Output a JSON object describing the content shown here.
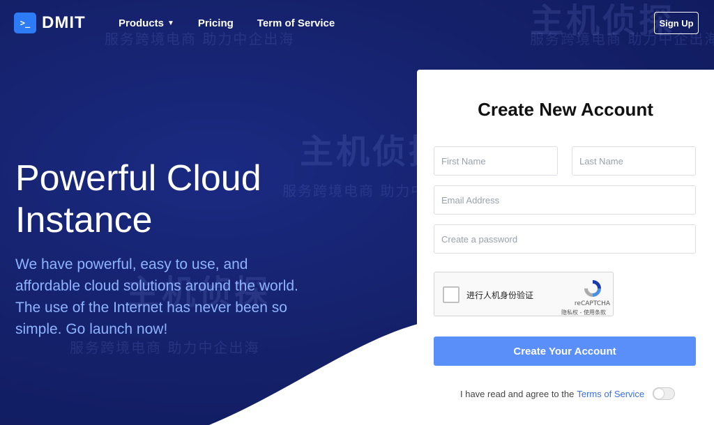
{
  "colors": {
    "background": "#131f6b",
    "accent": "#2d7cf6",
    "button": "#5a8ef8",
    "hero_text": "#8fb4ff",
    "link": "#3a6fd8"
  },
  "header": {
    "logo_icon": ">_",
    "logo_text": "DMIT",
    "nav": [
      {
        "label": "Products",
        "has_dropdown": true
      },
      {
        "label": "Pricing"
      },
      {
        "label": "Term of Service"
      }
    ],
    "signup_label": "Sign Up"
  },
  "hero": {
    "title_line1": "Powerful Cloud",
    "title_line2": "Instance",
    "description": "We have powerful, easy to use, and affordable cloud solutions around the world. The use of the Internet has never been so simple. Go launch now!"
  },
  "form": {
    "title": "Create New Account",
    "first_name_placeholder": "First Name",
    "last_name_placeholder": "Last Name",
    "email_placeholder": "Email Address",
    "password_placeholder": "Create a password",
    "recaptcha": {
      "label": "进行人机身份验证",
      "brand": "reCAPTCHA",
      "links": "隐私权 - 使用条款"
    },
    "submit_label": "Create Your Account",
    "agree_text": "I have read and agree to the",
    "agree_link": "Terms of Service"
  },
  "watermark": {
    "brand": "主机侦探",
    "slogan": "服务跨境电商 助力中企出海"
  }
}
